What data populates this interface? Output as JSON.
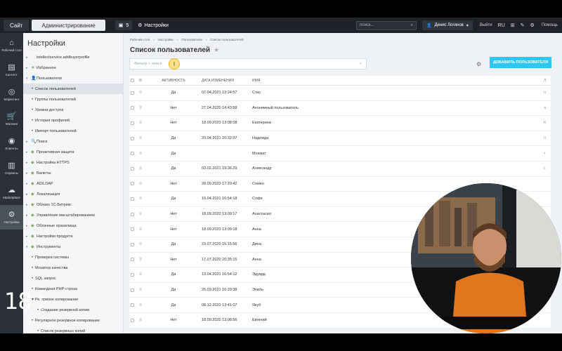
{
  "topbar": {
    "site_tab": "Сайт",
    "admin_tab": "Администрирование",
    "notif_count": "5",
    "settings_label": "Настройки",
    "search_placeholder": "поиск...",
    "user_name": "Денис Логинов",
    "logout": "Выйти",
    "lang": "RU",
    "help": "Помощь"
  },
  "rail": [
    {
      "icon": "home-icon",
      "label": "Рабочий стол",
      "glyph": "⌂"
    },
    {
      "icon": "content-icon",
      "label": "Контент",
      "glyph": "▤"
    },
    {
      "icon": "marketing-icon",
      "label": "Маркетинг",
      "glyph": "◎"
    },
    {
      "icon": "store-icon",
      "label": "Магазин",
      "glyph": "🛒"
    },
    {
      "icon": "clients-icon",
      "label": "Клиенты",
      "glyph": "◉"
    },
    {
      "icon": "services-icon",
      "label": "Сервисы",
      "glyph": "▥"
    },
    {
      "icon": "marketplace-icon",
      "label": "Marketplace",
      "glyph": "☁"
    },
    {
      "icon": "settings-icon",
      "label": "Настройки",
      "glyph": "⚙"
    }
  ],
  "tree": {
    "title": "Настройки",
    "items": [
      {
        "label": "intellectservice.addbuyerprofile",
        "level": 0,
        "arrow": "",
        "icon": ""
      },
      {
        "label": "Избранное",
        "level": 0,
        "arrow": "▸",
        "icon": "★"
      },
      {
        "label": "Пользователи",
        "level": 0,
        "arrow": "▾",
        "icon": "👤"
      },
      {
        "label": "Список пользователей",
        "level": 1,
        "active": true
      },
      {
        "label": "Группы пользователей",
        "level": 1
      },
      {
        "label": "Уровни доступа",
        "level": 1
      },
      {
        "label": "История профилей",
        "level": 1
      },
      {
        "label": "Импорт пользователей",
        "level": 1
      },
      {
        "label": "Поиск",
        "level": 0,
        "arrow": "▸",
        "icon": "🔍"
      },
      {
        "label": "Проактивная защита",
        "level": 0,
        "arrow": "▸",
        "icon": "◆"
      },
      {
        "label": "Настройка HTTPS",
        "level": 0,
        "arrow": "▸",
        "icon": "◆"
      },
      {
        "label": "Валюты",
        "level": 0,
        "arrow": "▸",
        "icon": "◆"
      },
      {
        "label": "AD/LDAP",
        "level": 0,
        "arrow": "▸",
        "icon": "◆"
      },
      {
        "label": "Локализация",
        "level": 0,
        "arrow": "▸",
        "icon": "◆"
      },
      {
        "label": "Облако 1С-Битрикс",
        "level": 0,
        "arrow": "▸",
        "icon": "◆"
      },
      {
        "label": "Управление масштабированием",
        "level": 0,
        "arrow": "▸",
        "icon": "◆"
      },
      {
        "label": "Облачные хранилища",
        "level": 0,
        "arrow": "▸",
        "icon": "◆"
      },
      {
        "label": "Настройки продукта",
        "level": 0,
        "arrow": "▸",
        "icon": "◆"
      },
      {
        "label": "Инструменты",
        "level": 0,
        "arrow": "▾",
        "icon": "◆"
      },
      {
        "label": "Проверка системы",
        "level": 1
      },
      {
        "label": "Монитор качества",
        "level": 1
      },
      {
        "label": "SQL запрос",
        "level": 1
      },
      {
        "label": "Командная PHP-строка",
        "level": 1
      },
      {
        "label": "Резервное копирование",
        "level": 1,
        "arrow": "▾"
      },
      {
        "label": "Создание резервной копии",
        "level": 2
      },
      {
        "label": "Регулярное резервное копирование",
        "level": 1
      },
      {
        "label": "Список резервных копий",
        "level": 2
      }
    ]
  },
  "breadcrumbs": [
    "Рабочий стол",
    "Настройки",
    "Пользователи",
    "Список пользователей"
  ],
  "page_title": "Список пользователей",
  "filter_placeholder": "Фильтр + поиск",
  "add_button": "ДОБАВИТЬ ПОЛЬЗОВАТЕЛЯ",
  "table": {
    "headers": {
      "active": "АКТИВНОСТЬ",
      "date": "ДАТА ИЗМЕНЕНИЯ",
      "name": "ИМЯ",
      "end": "Л"
    },
    "rows": [
      {
        "active": "Да",
        "date": "07.04.2021 13:24:57",
        "name": "Стас",
        "end": "п"
      },
      {
        "active": "Нет",
        "date": "27.04.2020 14:43:58",
        "name": "Анонимный пользователь",
        "end": "а"
      },
      {
        "active": "Нет",
        "date": "18.09.2020 13:08:08",
        "name": "Екатерина",
        "end": "К"
      },
      {
        "active": "Да",
        "date": "20.04.2021 20:32:27",
        "name": "Надежда",
        "end": "н"
      },
      {
        "active": "Да",
        "date": "",
        "name": "Мохмат",
        "end": "т"
      },
      {
        "active": "Да",
        "date": "03.02.2021 19:36:29",
        "name": "Александр",
        "end": "с"
      },
      {
        "active": "Нет",
        "date": "28.09.2020 17:20:42",
        "name": "Семен",
        "end": ""
      },
      {
        "active": "Да",
        "date": "16.04.2021 16:54:18",
        "name": "Софи",
        "end": ""
      },
      {
        "active": "Нет",
        "date": "18.09.2020 13:09:17",
        "name": "Анастасия",
        "end": ""
      },
      {
        "active": "Нет",
        "date": "18.09.2020 13:09:18",
        "name": "Анна",
        "end": ""
      },
      {
        "active": "Да",
        "date": "23.07.2020 15:15:56",
        "name": "Дина",
        "end": ""
      },
      {
        "active": "Нет",
        "date": "17.07.2020 20:35:15",
        "name": "Анна",
        "end": ""
      },
      {
        "active": "Да",
        "date": "13.04.2021 16:54:12",
        "name": "Эдуард",
        "end": ""
      },
      {
        "active": "Да",
        "date": "26.03.2021 16:20:38",
        "name": "Элиль",
        "end": ""
      },
      {
        "active": "Да",
        "date": "08.12.2020 13:41:07",
        "name": "Якуб",
        "end": ""
      },
      {
        "active": "Нет",
        "date": "18.09.2020 13:08:56",
        "name": "Евгений",
        "end": ""
      }
    ]
  },
  "age_badge": "18+",
  "colors": {
    "accent": "#2fc6f6",
    "topbar": "#1f2329",
    "rail": "#2c3138"
  }
}
